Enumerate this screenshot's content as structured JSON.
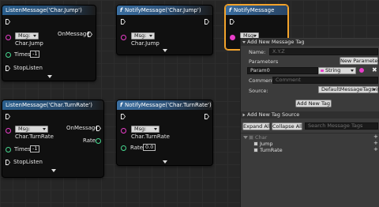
{
  "nodes": {
    "listen_jump": {
      "title": "ListenMessage('Char.Jump')",
      "msg_dropdown": "Msg:",
      "msg_value": "Char.Jump",
      "on_message": "OnMessage",
      "times_label": "Times",
      "times_value": "-1",
      "stop_listen": "StopListen"
    },
    "notify_jump": {
      "title": "NotifyMessage('Char.Jump')",
      "msg_dropdown": "Msg:",
      "msg_value": "Char.Jump"
    },
    "notify_selected": {
      "title": "NotifyMessage",
      "msg_dropdown": "Msg:"
    },
    "listen_turnrate": {
      "title": "ListenMessage('Char.TurnRate')",
      "msg_dropdown": "Msg:",
      "msg_value": "Char.TurnRate",
      "on_message": "OnMessage",
      "rate_out": "Rate",
      "times_label": "Times",
      "times_value": "-1",
      "stop_listen": "StopListen"
    },
    "notify_turnrate": {
      "title": "NotifyMessage('Char.TurnRate')",
      "msg_dropdown": "Msg:",
      "msg_value": "Char.TurnRate",
      "rate_label": "Rate",
      "rate_value": "0.0"
    }
  },
  "panel": {
    "add_new_section": "Add New Message Tag",
    "name_label": "Name:",
    "name_placeholder": "X.Y.Z",
    "parameters_label": "Parameters",
    "new_parameter_button": "New Parameter",
    "param_name": "Param0",
    "param_type": "String",
    "comment_label": "Comment:",
    "comment_placeholder": "Comment",
    "source_label": "Source:",
    "source_value": "DefaultMessageTags.ini",
    "add_new_tag_button": "Add New Tag",
    "add_source_section": "Add New Tag Source",
    "expand_all": "Expand All",
    "collapse_all": "Collapse All",
    "search_placeholder": "Search Message Tags",
    "tree": [
      {
        "label": "Char"
      },
      {
        "label": "Jump"
      },
      {
        "label": "TurnRate"
      }
    ]
  },
  "colors": {
    "header_blue": "#2d5279",
    "selected_outline": "#f3a32b",
    "pin_pink": "#e93ec9",
    "pin_green": "#48d890"
  }
}
